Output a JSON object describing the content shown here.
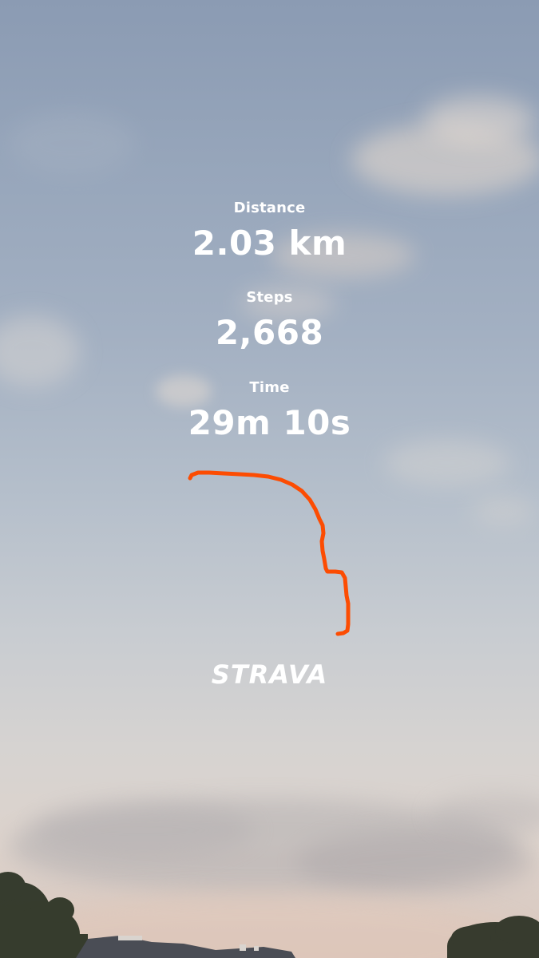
{
  "stats": {
    "distance": {
      "label": "Distance",
      "value": "2.03 km"
    },
    "steps": {
      "label": "Steps",
      "value": "2,668"
    },
    "time": {
      "label": "Time",
      "value": "29m 10s"
    }
  },
  "brand": {
    "name": "STRAVA"
  },
  "colors": {
    "route": "#fc4c02",
    "text": "#ffffff"
  }
}
